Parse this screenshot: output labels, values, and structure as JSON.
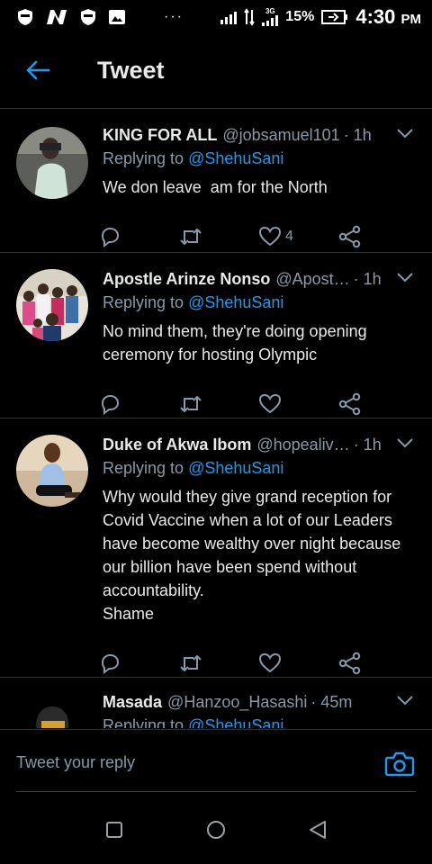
{
  "status_bar": {
    "network": "3G",
    "battery": "15%",
    "time": "4:30",
    "ampm": "PM",
    "dots": "···"
  },
  "header": {
    "title": "Tweet"
  },
  "tweets": [
    {
      "name": "KING FOR ALL",
      "handle": "@jobsamuel101",
      "time": "· 1h",
      "replying_prefix": "Replying to ",
      "replying_to": "@ShehuSani",
      "body": "We don leave  am for the North",
      "like_count": "4"
    },
    {
      "name": "Apostle Arinze Nonso",
      "handle": "@Apost…",
      "time": "· 1h",
      "replying_prefix": "Replying to ",
      "replying_to": "@ShehuSani",
      "body": "No mind them, they're doing opening ceremony for hosting Olympic",
      "like_count": ""
    },
    {
      "name": "Duke of Akwa Ibom",
      "handle": "@hopealiv…",
      "time": "· 1h",
      "replying_prefix": "Replying to ",
      "replying_to": "@ShehuSani",
      "body": "Why would they give grand reception for Covid Vaccine when a lot of our Leaders have become wealthy over night because our billion have been spend without accountability.\nShame",
      "like_count": ""
    },
    {
      "name": "Masada",
      "handle": "@Hanzoo_Hasashi",
      "time": "· 45m",
      "replying_prefix": "Replying to ",
      "replying_to": "@ShehuSani",
      "body": "",
      "like_count": ""
    }
  ],
  "reply_bar": {
    "placeholder": "Tweet your reply"
  },
  "colors": {
    "accent": "#1d9bf0",
    "background": "#000000",
    "secondary_text": "#8b98a5"
  }
}
